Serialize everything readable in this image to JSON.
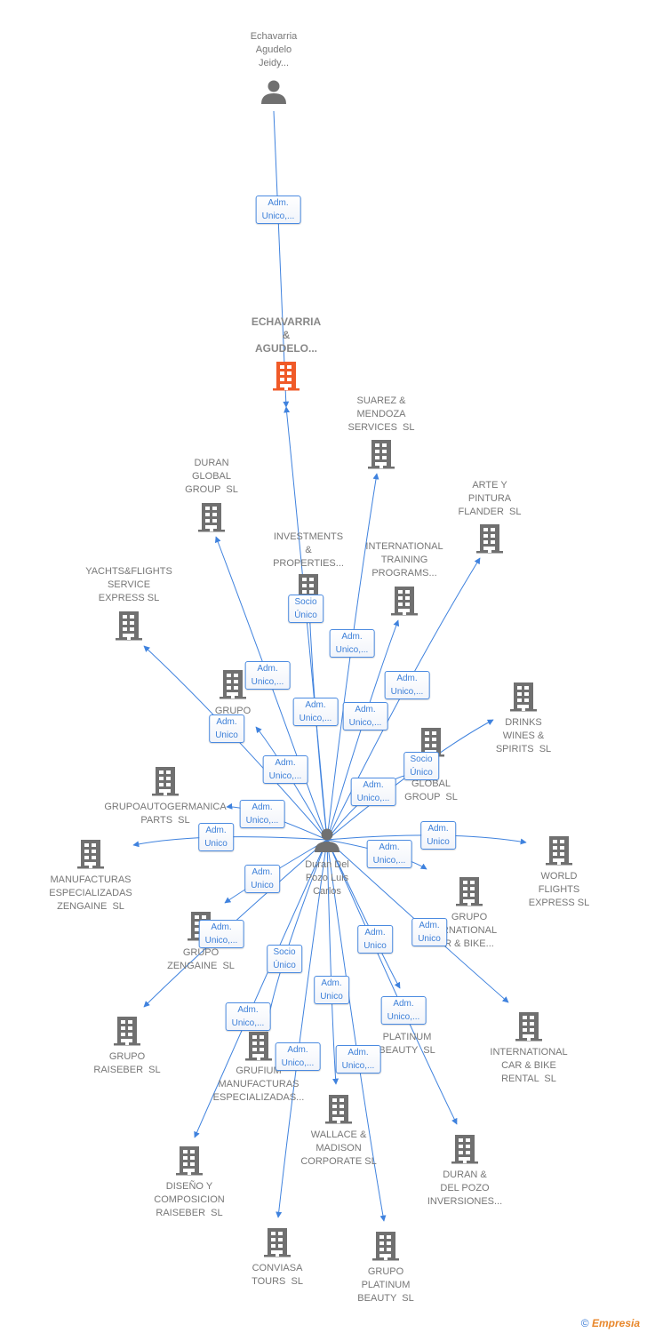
{
  "colors": {
    "edge": "#3f82de",
    "building": "#707070",
    "highlight": "#f05a28",
    "text": "#777777"
  },
  "persons": [
    {
      "id": "p1",
      "label": "Echavarria\nAgudelo\nJeidy...",
      "icon": "person-icon"
    },
    {
      "id": "p0",
      "label": "Duran Del\nPozo Luis\nCarlos",
      "icon": "person-icon"
    }
  ],
  "companies": [
    {
      "id": "ech",
      "label": "ECHAVARRIA\n&\nAGUDELO...",
      "highlight": true,
      "icon": "building-icon"
    },
    {
      "id": "suarez",
      "label": "SUAREZ &\nMENDOZA\nSERVICES  SL",
      "icon": "building-icon"
    },
    {
      "id": "dgg",
      "label": "DURAN\nGLOBAL\nGROUP  SL",
      "icon": "building-icon"
    },
    {
      "id": "arte",
      "label": "ARTE Y\nPINTURA\nFLANDER  SL",
      "icon": "building-icon"
    },
    {
      "id": "inv",
      "label": "INVESTMENTS\n&\nPROPERTIES...",
      "icon": "building-icon"
    },
    {
      "id": "itp",
      "label": "INTERNATIONAL\nTRAINING\nPROGRAMS...",
      "icon": "building-icon"
    },
    {
      "id": "yachts",
      "label": "YACHTS&FLIGHTS\nSERVICE\nEXPRESS SL",
      "icon": "building-icon"
    },
    {
      "id": "grupoen",
      "label": "GRUPO\nEN\n...",
      "icon": "building-icon"
    },
    {
      "id": "drinks",
      "label": "DRINKS\nWINES &\nSPIRITS  SL",
      "icon": "building-icon"
    },
    {
      "id": "engg",
      "label": "EN\nGLOBAL\nGROUP  SL",
      "icon": "building-icon"
    },
    {
      "id": "gag",
      "label": "GRUPOAUTOGERMANICA\nPARTS  SL",
      "icon": "building-icon"
    },
    {
      "id": "mez",
      "label": "MANUFACTURAS\nESPECIALIZADAS\nZENGAINE  SL",
      "icon": "building-icon"
    },
    {
      "id": "wfe",
      "label": "WORLD\nFLIGHTS\nEXPRESS SL",
      "icon": "building-icon"
    },
    {
      "id": "gicb",
      "label": "GRUPO\nRNATIONAL\nR & BIKE...",
      "icon": "building-icon"
    },
    {
      "id": "gz",
      "label": "GRUPO\nZENGAINE  SL",
      "icon": "building-icon"
    },
    {
      "id": "gr",
      "label": "GRUPO\nRAISEBER  SL",
      "icon": "building-icon"
    },
    {
      "id": "icbr",
      "label": "INTERNATIONAL\nCAR & BIKE\nRENTAL  SL",
      "icon": "building-icon"
    },
    {
      "id": "pb",
      "label": "PLATINUM\nBEAUTY  SL",
      "icon": "building-icon"
    },
    {
      "id": "grufium",
      "label": "GRUFIUM\nMANUFACTURAS\nESPECIALIZADAS...",
      "icon": "building-icon"
    },
    {
      "id": "wallace",
      "label": "WALLACE &\nMADISON\nCORPORATE SL",
      "icon": "building-icon"
    },
    {
      "id": "ddp",
      "label": "DURAN &\nDEL POZO\nINVERSIONES...",
      "icon": "building-icon"
    },
    {
      "id": "diseno",
      "label": "DISEÑO Y\nCOMPOSICION\nRAISEBER  SL",
      "icon": "building-icon"
    },
    {
      "id": "conviasa",
      "label": "CONVIASA\nTOURS  SL",
      "icon": "building-icon"
    },
    {
      "id": "gpb",
      "label": "GRUPO\nPLATINUM\nBEAUTY  SL",
      "icon": "building-icon"
    }
  ],
  "edges": [
    {
      "from": "p1",
      "to": "ech",
      "label": "Adm.\nUnico,..."
    },
    {
      "from": "p0",
      "to": "ech",
      "label": "Socio\nÚnico"
    },
    {
      "from": "p0",
      "to": "suarez",
      "label": "Adm.\nUnico,..."
    },
    {
      "from": "p0",
      "to": "dgg",
      "label": "Adm.\nUnico,..."
    },
    {
      "from": "p0",
      "to": "arte",
      "label": "Adm.\nUnico,..."
    },
    {
      "from": "p0",
      "to": "inv",
      "label": "Adm.\nUnico,..."
    },
    {
      "from": "p0",
      "to": "itp",
      "label": "Adm.\nUnico,..."
    },
    {
      "from": "p0",
      "to": "yachts",
      "label": "Adm.\nUnico"
    },
    {
      "from": "p0",
      "to": "grupoen",
      "label": "Adm.\nUnico,..."
    },
    {
      "from": "p0",
      "to": "drinks",
      "label": "Socio\nÚnico"
    },
    {
      "from": "p0",
      "to": "engg",
      "label": "Adm.\nUnico,..."
    },
    {
      "from": "p0",
      "to": "gag",
      "label": "Adm.\nUnico,..."
    },
    {
      "from": "p0",
      "to": "mez",
      "label": "Adm.\nUnico"
    },
    {
      "from": "p0",
      "to": "wfe",
      "label": "Adm.\nUnico"
    },
    {
      "from": "p0",
      "to": "gicb",
      "label": "Adm.\nUnico,..."
    },
    {
      "from": "p0",
      "to": "gz",
      "label": "Adm.\nUnico"
    },
    {
      "from": "p0",
      "to": "gr",
      "label": "Adm.\nUnico,..."
    },
    {
      "from": "p0",
      "to": "icbr",
      "label": "Adm.\nUnico"
    },
    {
      "from": "p0",
      "to": "pb",
      "label": "Adm.\nUnico"
    },
    {
      "from": "p0",
      "to": "grufium",
      "label": "Socio\nÚnico"
    },
    {
      "from": "p0",
      "to": "diseno",
      "label": "Adm.\nUnico,..."
    },
    {
      "from": "p0",
      "to": "conviasa",
      "label": "Adm.\nUnico,..."
    },
    {
      "from": "p0",
      "to": "wallace",
      "label": "Adm.\nUnico"
    },
    {
      "from": "p0",
      "to": "ddp",
      "label": "Adm.\nUnico,..."
    },
    {
      "from": "p0",
      "to": "gpb",
      "label": "Adm.\nUnico,..."
    }
  ],
  "footer": {
    "copyright": "©",
    "brand": "Empresia"
  }
}
